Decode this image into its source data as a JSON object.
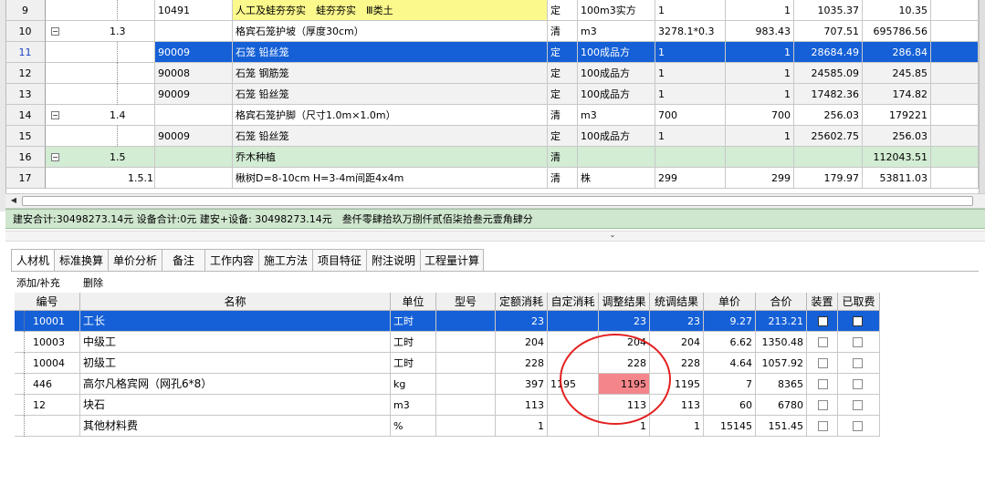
{
  "top_rows": [
    {
      "num": "9",
      "code": "",
      "sub": "10491",
      "name": "人工及蛙夯夯实　蛙夯夯实　Ⅲ类土",
      "type": "定",
      "unit": "100m3实方",
      "expr": "1",
      "qty": "1",
      "price": "1035.37",
      "total": "10.35",
      "style": "yellow"
    },
    {
      "num": "10",
      "code": "1.3",
      "sub": "",
      "name": "格宾石笼护坡（厚度30cm）",
      "type": "清",
      "unit": "m3",
      "expr": "3278.1*0.3",
      "qty": "983.43",
      "price": "707.51",
      "total": "695786.56",
      "style": "white"
    },
    {
      "num": "11",
      "code": "",
      "sub": "90009",
      "name": "石笼 铅丝笼",
      "type": "定",
      "unit": "100成品方",
      "expr": "1",
      "qty": "1",
      "price": "28684.49",
      "total": "286.84",
      "style": "selected"
    },
    {
      "num": "12",
      "code": "",
      "sub": "90008",
      "name": "石笼 钢筋笼",
      "type": "定",
      "unit": "100成品方",
      "expr": "1",
      "qty": "1",
      "price": "24585.09",
      "total": "245.85",
      "style": "gray"
    },
    {
      "num": "13",
      "code": "",
      "sub": "90009",
      "name": "石笼 铅丝笼",
      "type": "定",
      "unit": "100成品方",
      "expr": "1",
      "qty": "1",
      "price": "17482.36",
      "total": "174.82",
      "style": "gray"
    },
    {
      "num": "14",
      "code": "1.4",
      "sub": "",
      "name": "格宾石笼护脚（尺寸1.0m×1.0m）",
      "type": "清",
      "unit": "m3",
      "expr": "700",
      "qty": "700",
      "price": "256.03",
      "total": "179221",
      "style": "white"
    },
    {
      "num": "15",
      "code": "",
      "sub": "90009",
      "name": "石笼 铅丝笼",
      "type": "定",
      "unit": "100成品方",
      "expr": "1",
      "qty": "1",
      "price": "25602.75",
      "total": "256.03",
      "style": "gray"
    },
    {
      "num": "16",
      "code": "1.5",
      "sub": "",
      "name": "乔木种植",
      "type": "清",
      "unit": "",
      "expr": "",
      "qty": "",
      "price": "",
      "total": "112043.51",
      "style": "green"
    },
    {
      "num": "17",
      "code": "1.5.1",
      "sub": "",
      "name": "楸树D=8-10cm H=3-4m间距4x4m",
      "type": "清",
      "unit": "株",
      "expr": "299",
      "qty": "299",
      "price": "179.97",
      "total": "53811.03",
      "style": "white"
    }
  ],
  "summary": "建安合计:30498273.14元 设备合计:0元 建安+设备: 30498273.14元　叁仟零肆拾玖万捌仟贰佰柒拾叁元壹角肆分",
  "tabs": [
    "人材机",
    "标准换算",
    "单价分析",
    "备注",
    "工作内容",
    "施工方法",
    "项目特征",
    "附注说明",
    "工程量计算"
  ],
  "toolbar": {
    "add": "添加/补充",
    "delete": "删除"
  },
  "bottom_headers": [
    "编号",
    "名称",
    "单位",
    "型号",
    "定额消耗",
    "自定消耗",
    "调整结果",
    "统调结果",
    "单价",
    "合价",
    "装置",
    "已取费"
  ],
  "bottom_rows": [
    {
      "code": "10001",
      "name": "工长",
      "unit": "工时",
      "model": "",
      "quota": "23",
      "custom": "",
      "adjust": "23",
      "unified": "23",
      "price": "9.27",
      "total": "213.21",
      "selected": true
    },
    {
      "code": "10003",
      "name": "中级工",
      "unit": "工时",
      "model": "",
      "quota": "204",
      "custom": "",
      "adjust": "204",
      "unified": "204",
      "price": "6.62",
      "total": "1350.48",
      "selected": false
    },
    {
      "code": "10004",
      "name": "初级工",
      "unit": "工时",
      "model": "",
      "quota": "228",
      "custom": "",
      "adjust": "228",
      "unified": "228",
      "price": "4.64",
      "total": "1057.92",
      "selected": false
    },
    {
      "code": "446",
      "name": "高尔凡格宾网（网孔6*8）",
      "unit": "kg",
      "model": "",
      "quota": "397",
      "custom": "1195",
      "adjust": "1195",
      "unified": "1195",
      "price": "7",
      "total": "8365",
      "selected": false
    },
    {
      "code": "12",
      "name": "块石",
      "unit": "m3",
      "model": "",
      "quota": "113",
      "custom": "",
      "adjust": "113",
      "unified": "113",
      "price": "60",
      "total": "6780",
      "selected": false
    },
    {
      "code": "",
      "name": "其他材料费",
      "unit": "%",
      "model": "",
      "quota": "1",
      "custom": "",
      "adjust": "1",
      "unified": "1",
      "price": "15145",
      "total": "151.45",
      "selected": false
    }
  ],
  "colors": {
    "selected": "#1560d7",
    "yellow_row": "#fbf98c",
    "green_row": "#d3ecd4",
    "gray_row": "#f2f2f2",
    "highlight": "#f4868b",
    "circle": "#e32020"
  }
}
